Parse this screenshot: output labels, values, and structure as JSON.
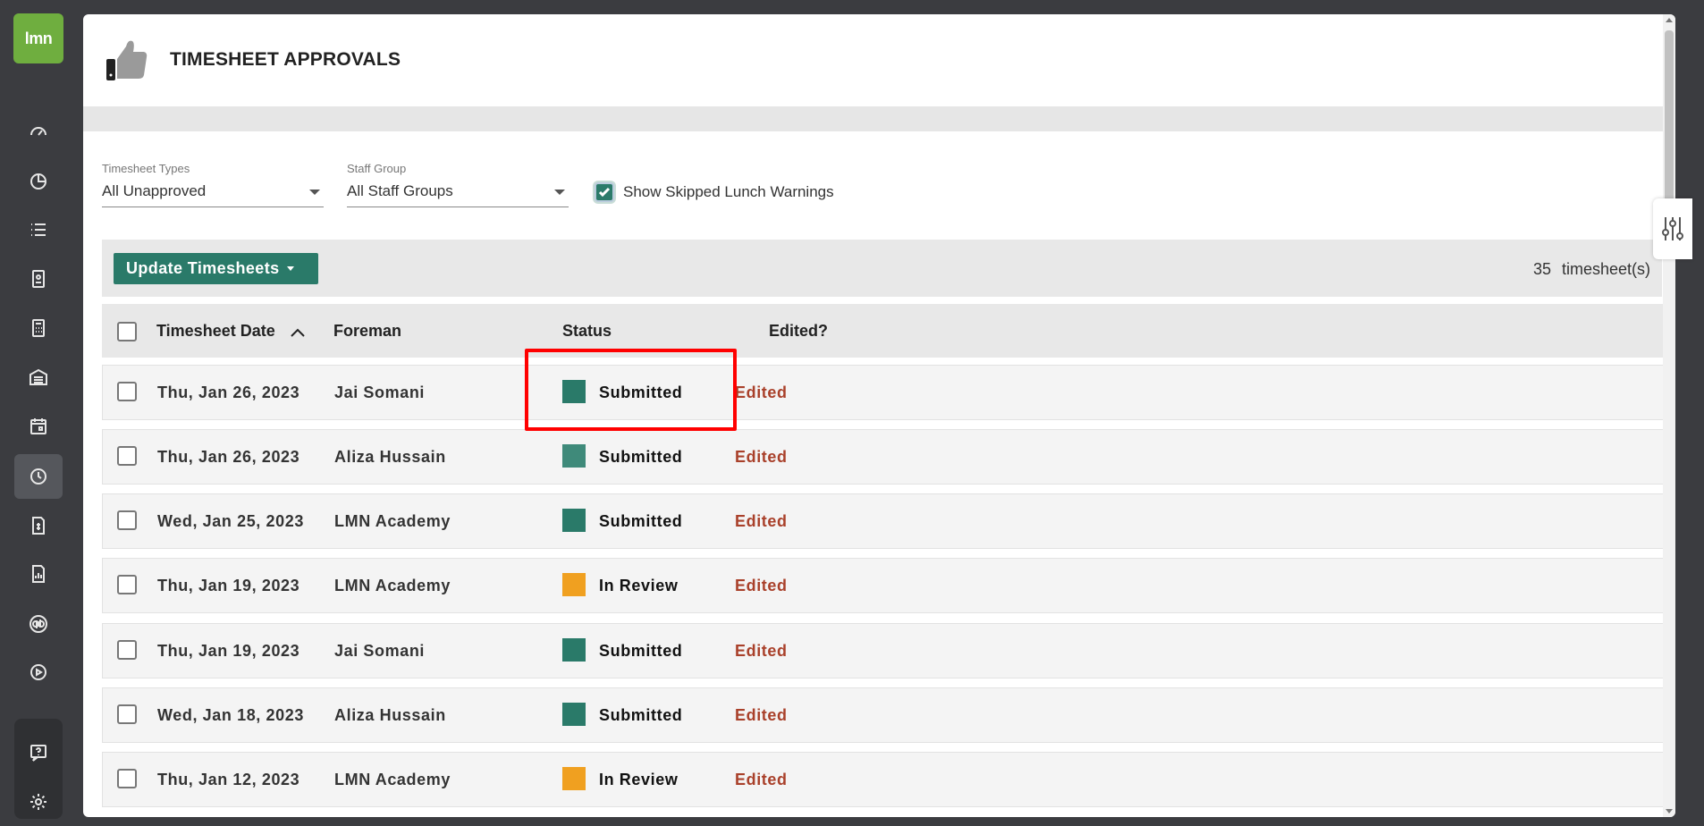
{
  "app": {
    "logo_text": "lmn"
  },
  "page": {
    "title": "TIMESHEET APPROVALS"
  },
  "filters": {
    "timesheet_types": {
      "label": "Timesheet Types",
      "value": "All Unapproved"
    },
    "staff_group": {
      "label": "Staff Group",
      "value": "All Staff Groups"
    },
    "skipped_lunch": {
      "label": "Show Skipped Lunch Warnings",
      "checked": true
    }
  },
  "toolbar": {
    "update_label": "Update Timesheets",
    "count_number": "35",
    "count_label": "timesheet(s)"
  },
  "table": {
    "headers": {
      "date": "Timesheet Date",
      "foreman": "Foreman",
      "status": "Status",
      "edited": "Edited?"
    },
    "rows": [
      {
        "date": "Thu, Jan 26, 2023",
        "foreman": "Jai Somani",
        "status": "Submitted",
        "status_color": "#2a7a69",
        "edited": "Edited"
      },
      {
        "date": "Thu, Jan 26, 2023",
        "foreman": "Aliza Hussain",
        "status": "Submitted",
        "status_color": "#3f8a7a",
        "edited": "Edited"
      },
      {
        "date": "Wed, Jan 25, 2023",
        "foreman": "LMN Academy",
        "status": "Submitted",
        "status_color": "#2a7a69",
        "edited": "Edited"
      },
      {
        "date": "Thu, Jan 19, 2023",
        "foreman": "LMN Academy",
        "status": "In Review",
        "status_color": "#f0a020",
        "edited": "Edited"
      },
      {
        "date": "Thu, Jan 19, 2023",
        "foreman": "Jai Somani",
        "status": "Submitted",
        "status_color": "#2a7a69",
        "edited": "Edited"
      },
      {
        "date": "Wed, Jan 18, 2023",
        "foreman": "Aliza Hussain",
        "status": "Submitted",
        "status_color": "#2a7a69",
        "edited": "Edited"
      },
      {
        "date": "Thu, Jan 12, 2023",
        "foreman": "LMN Academy",
        "status": "In Review",
        "status_color": "#f0a020",
        "edited": "Edited"
      }
    ]
  },
  "colors": {
    "accent": "#2a7a69",
    "edited": "#a9402a",
    "highlight": "#ff0000",
    "logo": "#6fae3f"
  }
}
